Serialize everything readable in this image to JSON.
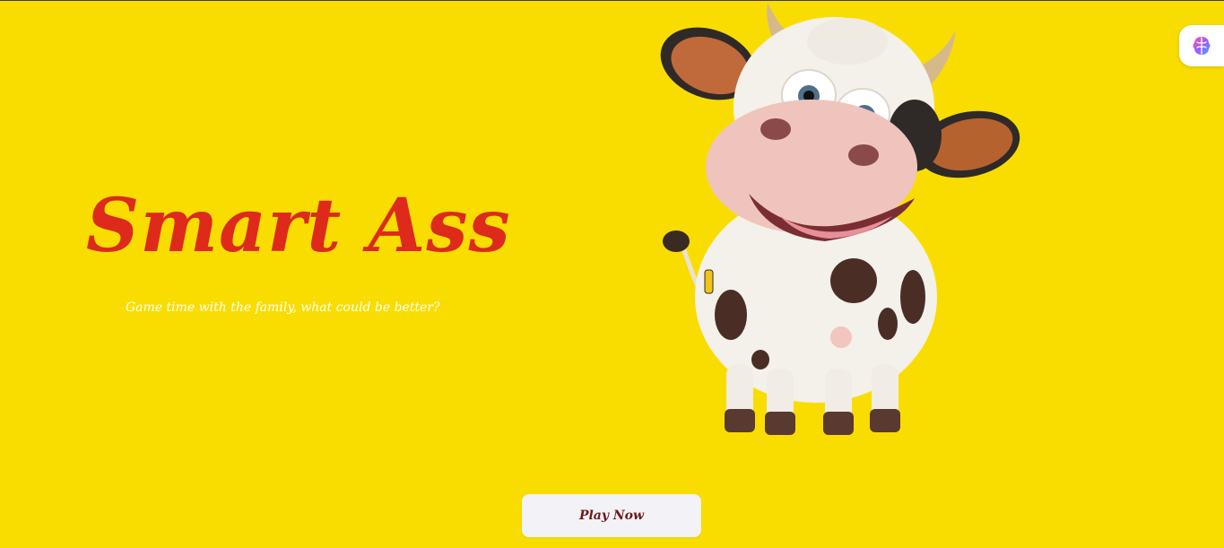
{
  "game": {
    "title": "Smart Ass",
    "tagline": "Game time with the family, what could be better?",
    "play_button": "Play Now"
  },
  "icons": {
    "mascot": "cartoon-cow-icon",
    "widget": "brain-icon"
  },
  "colors": {
    "background": "#FADD00",
    "title": "#DD2A1B",
    "tagline": "#FFFFFF",
    "button_bg": "#F2F2F7",
    "button_text": "#6B1A1A"
  }
}
